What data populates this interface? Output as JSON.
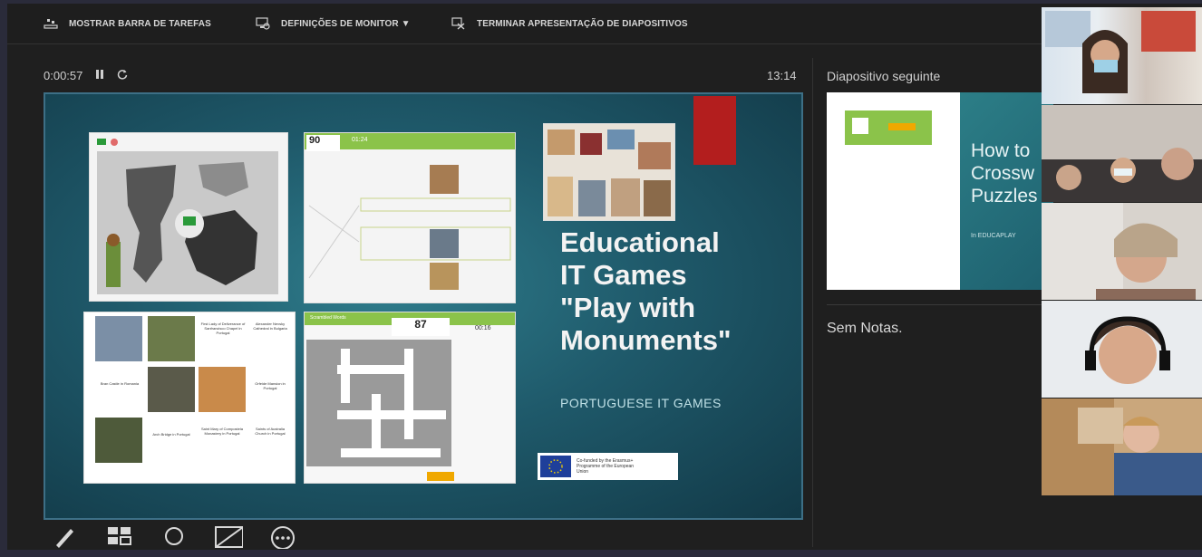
{
  "toolbar": {
    "taskbar_label": "MOSTRAR BARRA DE TAREFAS",
    "monitor_label": "DEFINIÇÕES DE MONITOR ▼",
    "end_label": "TERMINAR APRESENTAÇÃO DE DIAPOSITIVOS"
  },
  "timer": {
    "elapsed": "0:00:57",
    "clock": "13:14"
  },
  "next_slide": {
    "label": "Diapositivo seguinte",
    "title": "How to\nCrossw\nPuzzles",
    "small": "In EDUCAPLAY"
  },
  "slide": {
    "title": "Educational\nIT Games\n\"Play with\nMonuments\"",
    "subtitle": "PORTUGUESE  IT GAMES",
    "scores": {
      "top": "90",
      "top_time": "01:24",
      "bottom": "87",
      "bottom_time": "00:16"
    },
    "tile_header": "Scrambled Words",
    "match_cells": [
      "First Lady of Deliverance of Sanfrancisco Chapel in Portugal",
      "Alexander Nevsky Cathedral in Bulgaria",
      "Bran Castle in Romania",
      "Orfeide Mansion in Portugal",
      "Arch Bridge in Portugal",
      "Saint Mary of Compostela Monastery in Portugal",
      "Saints of Australia Church in Portugal"
    ],
    "eu_text": "Co-funded by the Erasmus+ Programme of the European Union"
  },
  "notes": {
    "text": "Sem Notas."
  },
  "participants": [
    "participant-1",
    "participant-2",
    "participant-3",
    "participant-4",
    "participant-5"
  ],
  "colors": {
    "slide_bg": "#1f5a6b",
    "accent_red": "#b31e1e",
    "eu_blue": "#1f3f9a"
  }
}
